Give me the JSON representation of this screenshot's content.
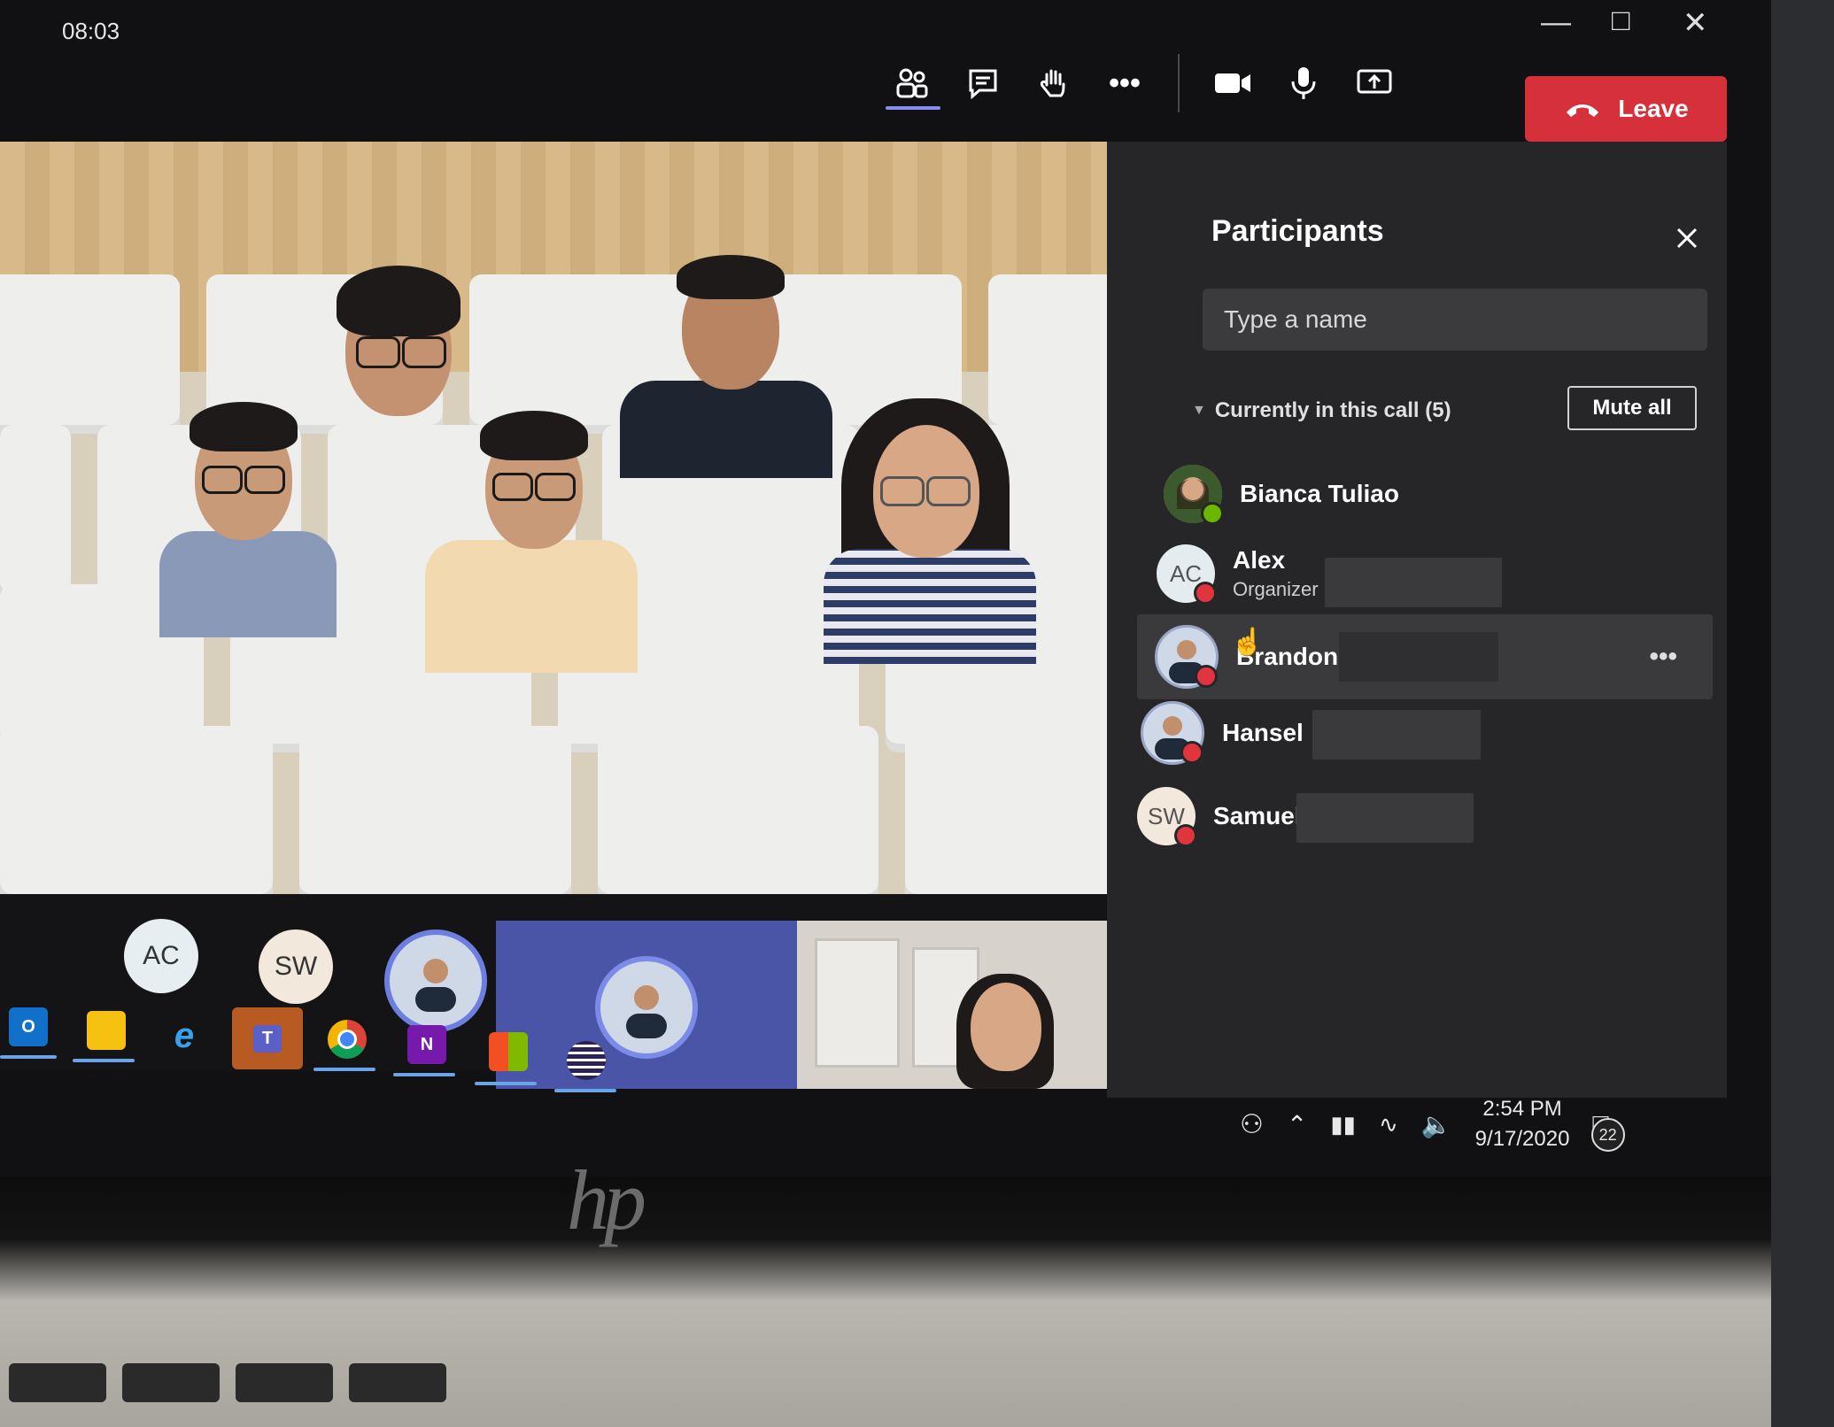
{
  "window": {
    "clock": "08:03",
    "minimize_icon": "minimize-icon",
    "maximize_icon": "maximize-icon",
    "close_icon": "close-icon"
  },
  "toolbar": {
    "buttons": [
      {
        "icon": "people-icon",
        "active": true
      },
      {
        "icon": "chat-icon"
      },
      {
        "icon": "raise-hand-icon"
      },
      {
        "icon": "more-icon"
      },
      {
        "icon": "camera-icon"
      },
      {
        "icon": "microphone-icon"
      },
      {
        "icon": "share-screen-icon"
      }
    ],
    "leave_label": "Leave",
    "leave_color": "#d6303a"
  },
  "filmstrip": {
    "avatars": [
      {
        "initials": "AC"
      },
      {
        "initials": "SW"
      }
    ]
  },
  "panel": {
    "title": "Participants",
    "search_placeholder": "Type a name",
    "section_label": "Currently in this call (5)",
    "mute_all_label": "Mute all",
    "participants": [
      {
        "name": "Bianca Tuliao",
        "role": "",
        "initials": "",
        "status": "available",
        "status_color": "#6bb700"
      },
      {
        "name": "Alex",
        "role": "Organizer",
        "initials": "AC",
        "status": "muted",
        "status_color": "#e0353f"
      },
      {
        "name": "Brandon",
        "role": "",
        "initials": "",
        "status": "muted",
        "status_color": "#e0353f"
      },
      {
        "name": "Hansel",
        "role": "",
        "initials": "",
        "status": "muted",
        "status_color": "#e0353f"
      },
      {
        "name": "Samuel",
        "role": "",
        "initials": "SW",
        "status": "muted",
        "status_color": "#e0353f"
      }
    ],
    "more_label": "•••"
  },
  "taskbar": {
    "apps": [
      "Outlook",
      "Sticky Notes",
      "Internet Explorer",
      "Teams",
      "Chrome",
      "OneNote",
      "Store",
      "Eclipse"
    ]
  },
  "tray": {
    "time": "2:54 PM",
    "date": "9/17/2020",
    "notification_count": "22"
  },
  "device": {
    "brand_logo": "hp"
  }
}
